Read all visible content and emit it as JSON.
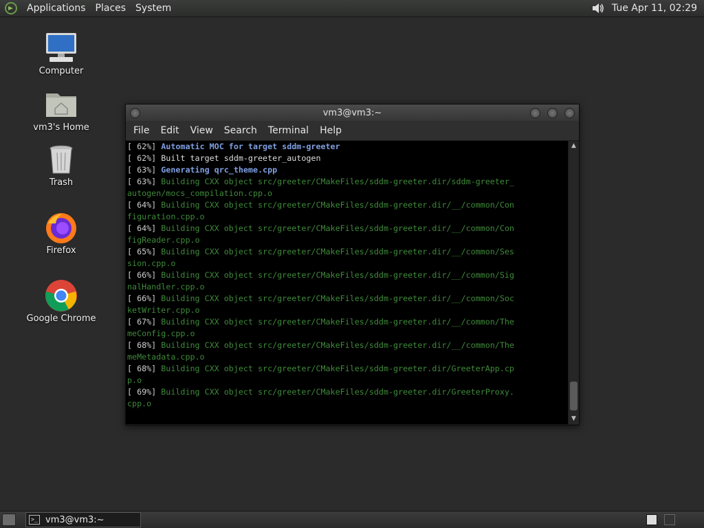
{
  "top_panel": {
    "menu": [
      "Applications",
      "Places",
      "System"
    ],
    "clock": "Tue Apr 11, 02:29"
  },
  "desktop_icons": [
    {
      "label": "Computer",
      "icon": "computer-icon"
    },
    {
      "label": "vm3's Home",
      "icon": "home-folder-icon"
    },
    {
      "label": "Trash",
      "icon": "trash-icon"
    },
    {
      "label": "Firefox",
      "icon": "firefox-icon"
    },
    {
      "label": "Google Chrome",
      "icon": "chrome-icon"
    }
  ],
  "window": {
    "title": "vm3@vm3:~",
    "menu": [
      "File",
      "Edit",
      "View",
      "Search",
      "Terminal",
      "Help"
    ]
  },
  "terminal_lines": [
    {
      "pct": "[ 62%]",
      "text": " Automatic MOC for target sddm-greeter",
      "style": "blue"
    },
    {
      "pct": "[ 62%]",
      "text": " Built target sddm-greeter_autogen",
      "style": "plain"
    },
    {
      "pct": "[ 63%]",
      "text": " Generating qrc_theme.cpp",
      "style": "blue"
    },
    {
      "pct": "[ 63%]",
      "text": " Building CXX object src/greeter/CMakeFiles/sddm-greeter.dir/sddm-greeter_",
      "style": "green"
    },
    {
      "pct": "",
      "text": "autogen/mocs_compilation.cpp.o",
      "style": "green"
    },
    {
      "pct": "[ 64%]",
      "text": " Building CXX object src/greeter/CMakeFiles/sddm-greeter.dir/__/common/Con",
      "style": "green"
    },
    {
      "pct": "",
      "text": "figuration.cpp.o",
      "style": "green"
    },
    {
      "pct": "[ 64%]",
      "text": " Building CXX object src/greeter/CMakeFiles/sddm-greeter.dir/__/common/Con",
      "style": "green"
    },
    {
      "pct": "",
      "text": "figReader.cpp.o",
      "style": "green"
    },
    {
      "pct": "[ 65%]",
      "text": " Building CXX object src/greeter/CMakeFiles/sddm-greeter.dir/__/common/Ses",
      "style": "green"
    },
    {
      "pct": "",
      "text": "sion.cpp.o",
      "style": "green"
    },
    {
      "pct": "[ 66%]",
      "text": " Building CXX object src/greeter/CMakeFiles/sddm-greeter.dir/__/common/Sig",
      "style": "green"
    },
    {
      "pct": "",
      "text": "nalHandler.cpp.o",
      "style": "green"
    },
    {
      "pct": "[ 66%]",
      "text": " Building CXX object src/greeter/CMakeFiles/sddm-greeter.dir/__/common/Soc",
      "style": "green"
    },
    {
      "pct": "",
      "text": "ketWriter.cpp.o",
      "style": "green"
    },
    {
      "pct": "[ 67%]",
      "text": " Building CXX object src/greeter/CMakeFiles/sddm-greeter.dir/__/common/The",
      "style": "green"
    },
    {
      "pct": "",
      "text": "meConfig.cpp.o",
      "style": "green"
    },
    {
      "pct": "[ 68%]",
      "text": " Building CXX object src/greeter/CMakeFiles/sddm-greeter.dir/__/common/The",
      "style": "green"
    },
    {
      "pct": "",
      "text": "meMetadata.cpp.o",
      "style": "green"
    },
    {
      "pct": "[ 68%]",
      "text": " Building CXX object src/greeter/CMakeFiles/sddm-greeter.dir/GreeterApp.cp",
      "style": "green"
    },
    {
      "pct": "",
      "text": "p.o",
      "style": "green"
    },
    {
      "pct": "[ 69%]",
      "text": " Building CXX object src/greeter/CMakeFiles/sddm-greeter.dir/GreeterProxy.",
      "style": "green"
    },
    {
      "pct": "",
      "text": "cpp.o",
      "style": "green"
    }
  ],
  "taskbar": {
    "task_label": "vm3@vm3:~"
  }
}
